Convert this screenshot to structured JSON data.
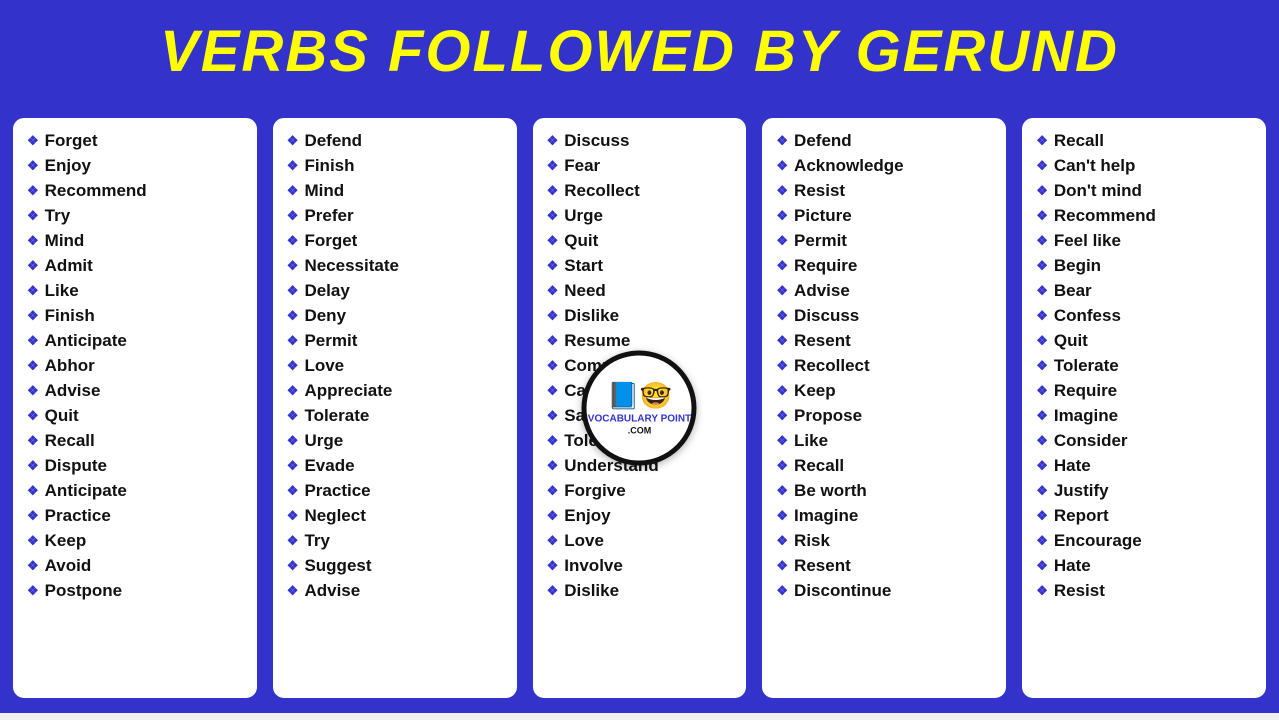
{
  "header": {
    "title": "VERBS FOLLOWED BY GERUND"
  },
  "columns": [
    {
      "id": "col1",
      "items": [
        "Forget",
        "Enjoy",
        "Recommend",
        "Try",
        "Mind",
        "Admit",
        "Like",
        "Finish",
        "Anticipate",
        "Abhor",
        "Advise",
        "Quit",
        "Recall",
        "Dispute",
        "Anticipate",
        "Practice",
        "Keep",
        "Avoid",
        "Postpone"
      ]
    },
    {
      "id": "col2",
      "items": [
        "Defend",
        "Finish",
        "Mind",
        "Prefer",
        "Forget",
        "Necessitate",
        "Delay",
        "Deny",
        "Permit",
        "Love",
        "Appreciate",
        "Tolerate",
        "Urge",
        "Evade",
        "Practice",
        "Neglect",
        "Try",
        "Suggest",
        "Advise"
      ]
    },
    {
      "id": "col3",
      "items": [
        "Discuss",
        "Fear",
        "Recollect",
        "Urge",
        "Quit",
        "Start",
        "Need",
        "Dislike",
        "Resume",
        "Complete",
        "Can't help",
        "Sanction",
        "Tolerate",
        "Understand",
        "Forgive",
        "Enjoy",
        "Love",
        "Involve",
        "Dislike"
      ]
    },
    {
      "id": "col4",
      "items": [
        "Defend",
        "Acknowledge",
        "Resist",
        "Picture",
        "Permit",
        "Require",
        "Advise",
        "Discuss",
        "Resent",
        "Recollect",
        "Keep",
        "Propose",
        "Like",
        "Recall",
        "Be worth",
        "Imagine",
        "Risk",
        "Resent",
        "Discontinue"
      ]
    },
    {
      "id": "col5",
      "items": [
        "Recall",
        "Can't help",
        "Don't mind",
        "Recommend",
        "Feel like",
        "Begin",
        "Bear",
        "Confess",
        "Quit",
        "Tolerate",
        "Require",
        "Imagine",
        "Consider",
        "Hate",
        "Justify",
        "Report",
        "Encourage",
        "Hate",
        "Resist"
      ]
    }
  ],
  "logo": {
    "line1": "VOCABULARY",
    "line2": "POINT",
    "line3": ".COM"
  }
}
